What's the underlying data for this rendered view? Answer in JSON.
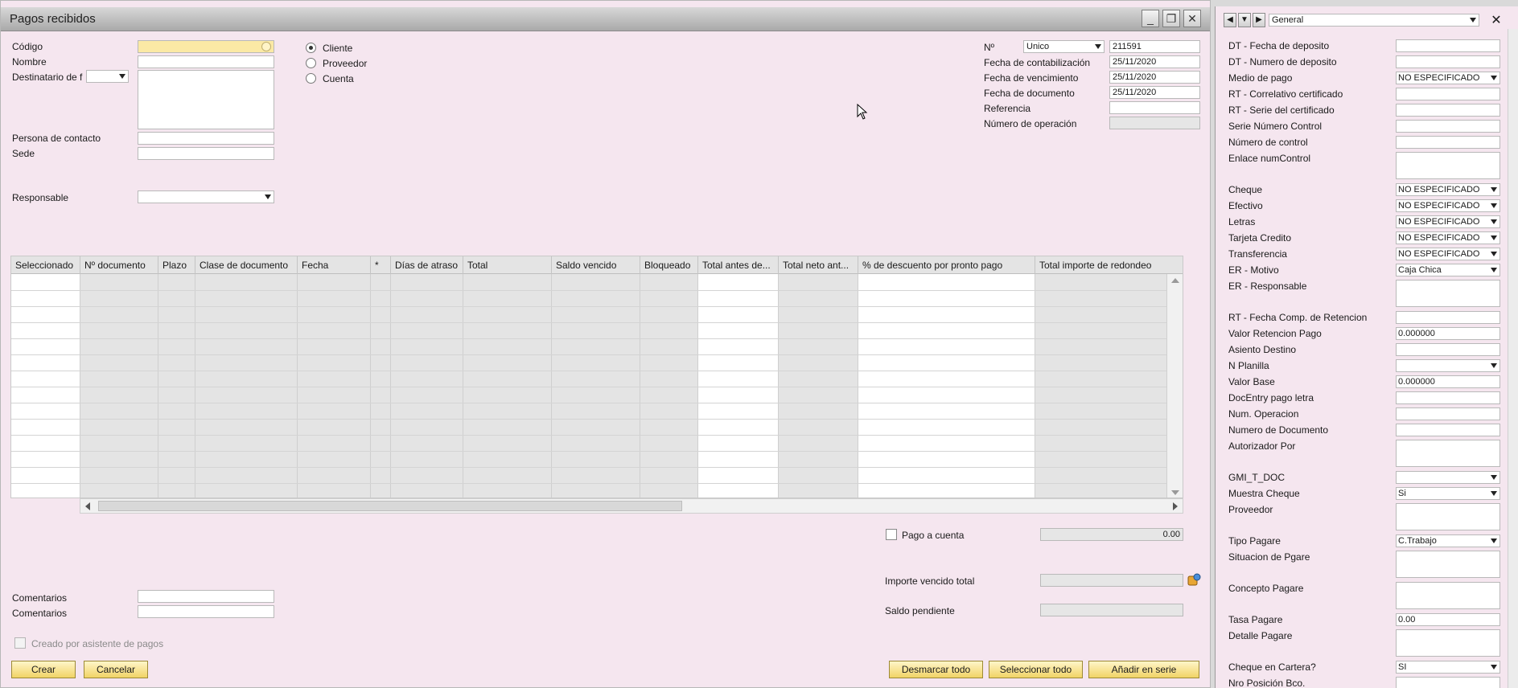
{
  "window": {
    "title": "Pagos recibidos"
  },
  "left_form": {
    "codigo_label": "Código",
    "nombre_label": "Nombre",
    "destinatario_label": "Destinatario de f",
    "persona_contacto_label": "Persona de contacto",
    "sede_label": "Sede",
    "responsable_label": "Responsable"
  },
  "partner_type": {
    "options": [
      {
        "label": "Cliente",
        "selected": true
      },
      {
        "label": "Proveedor",
        "selected": false
      },
      {
        "label": "Cuenta",
        "selected": false
      }
    ]
  },
  "header_right": {
    "no_label": "Nº",
    "series_value": "Unico",
    "number_value": "211591",
    "fecha_contab_label": "Fecha de contabilización",
    "fecha_contab_value": "25/11/2020",
    "fecha_venc_label": "Fecha de vencimiento",
    "fecha_venc_value": "25/11/2020",
    "fecha_doc_label": "Fecha de documento",
    "fecha_doc_value": "25/11/2020",
    "referencia_label": "Referencia",
    "num_operacion_label": "Número de operación"
  },
  "grid": {
    "columns": [
      "Seleccionado",
      "Nº documento",
      "Plazo",
      "Clase de documento",
      "Fecha",
      "*",
      "Días de atraso",
      "Total",
      "Saldo vencido",
      "Bloqueado",
      "Total antes de...",
      "Total neto ant...",
      "% de descuento por pronto pago",
      "Total importe de redondeo"
    ]
  },
  "footer": {
    "pago_a_cuenta_label": "Pago a cuenta",
    "pago_a_cuenta_value": "0.00",
    "importe_vencido_label": "Importe vencido total",
    "saldo_pendiente_label": "Saldo pendiente",
    "comentarios1_label": "Comentarios",
    "comentarios2_label": "Comentarios",
    "creado_asistente_label": "Creado por asistente de pagos",
    "crear_button": "Crear",
    "cancelar_button": "Cancelar",
    "desmarcar_button": "Desmarcar todo",
    "seleccionar_button": "Seleccionar todo",
    "anadir_serie_button": "Añadir en serie"
  },
  "side_panel": {
    "category_value": "General",
    "fields": [
      {
        "label": "DT - Fecha de deposito",
        "value": ""
      },
      {
        "label": "DT - Numero de deposito",
        "value": ""
      },
      {
        "label": "Medio de pago",
        "value": "NO ESPECIFICADO"
      },
      {
        "label": "RT - Correlativo certificado",
        "value": ""
      },
      {
        "label": "RT - Serie del certificado",
        "value": ""
      },
      {
        "label": "Serie Número Control",
        "value": ""
      },
      {
        "label": "Número de control",
        "value": ""
      },
      {
        "label": "Enlace numControl",
        "value": ""
      },
      {
        "label": "Cheque",
        "value": "NO ESPECIFICADO"
      },
      {
        "label": "Efectivo",
        "value": "NO ESPECIFICADO"
      },
      {
        "label": "Letras",
        "value": "NO ESPECIFICADO"
      },
      {
        "label": "Tarjeta Credito",
        "value": "NO ESPECIFICADO"
      },
      {
        "label": "Transferencia",
        "value": "NO ESPECIFICADO"
      },
      {
        "label": "ER - Motivo",
        "value": "Caja Chica"
      },
      {
        "label": "ER - Responsable",
        "value": ""
      },
      {
        "label": "RT - Fecha Comp. de Retencion",
        "value": ""
      },
      {
        "label": "Valor Retencion Pago",
        "value": "0.000000"
      },
      {
        "label": "Asiento Destino",
        "value": ""
      },
      {
        "label": "N Planilla",
        "value": ""
      },
      {
        "label": "Valor Base",
        "value": "0.000000"
      },
      {
        "label": "DocEntry pago letra",
        "value": ""
      },
      {
        "label": "Num. Operacion",
        "value": ""
      },
      {
        "label": "Numero de Documento",
        "value": ""
      },
      {
        "label": "Autorizador Por",
        "value": ""
      },
      {
        "label": "GMI_T_DOC",
        "value": ""
      },
      {
        "label": "Muestra Cheque",
        "value": "Si"
      },
      {
        "label": "Proveedor",
        "value": ""
      },
      {
        "label": "Tipo Pagare",
        "value": "C.Trabajo"
      },
      {
        "label": "Situacion de Pgare",
        "value": ""
      },
      {
        "label": "Concepto Pagare",
        "value": ""
      },
      {
        "label": "Tasa Pagare",
        "value": "0.00"
      },
      {
        "label": "Detalle Pagare",
        "value": ""
      },
      {
        "label": "Cheque en Cartera?",
        "value": "SI"
      },
      {
        "label": "Nro Posición Bco.",
        "value": ""
      }
    ]
  }
}
